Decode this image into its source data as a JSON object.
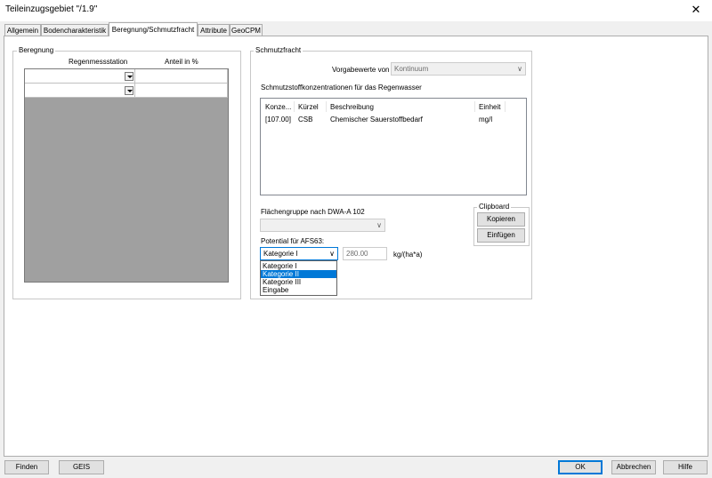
{
  "window": {
    "title": "Teileinzugsgebiet \"/1.9\"",
    "close_symbol": "✕"
  },
  "tabs": [
    {
      "label": "Allgemein"
    },
    {
      "label": "Bodencharakteristik"
    },
    {
      "label": "Beregnung/Schmutzfracht"
    },
    {
      "label": "Attribute"
    },
    {
      "label": "GeoCPM"
    }
  ],
  "beregnung": {
    "label": "Beregnung",
    "col_station": "Regenmessstation",
    "col_anteil": "Anteil in %"
  },
  "schmutzfracht": {
    "label": "Schmutzfracht",
    "vorgabe_label": "Vorgabewerte von",
    "vorgabe_value": "Kontinuum",
    "konz_label": "Schmutzstoffkonzentrationen für das Regenwasser",
    "table": {
      "headers": [
        "Konze...",
        "Kürzel",
        "Beschreibung",
        "Einheit"
      ],
      "rows": [
        {
          "konz": "[107.00]",
          "kuerzel": "CSB",
          "beschreibung": "Chemischer Sauerstoffbedarf",
          "einheit": "mg/l"
        }
      ]
    },
    "flaechen_label": "Flächengruppe nach DWA-A 102",
    "flaechen_value": "",
    "potential_label": "Potential für AFS63:",
    "potential_selected": "Kategorie I",
    "potential_value": "280.00",
    "potential_unit": "kg/(ha*a)",
    "potential_options": [
      "Kategorie I",
      "Kategorie II",
      "Kategorie III",
      "Eingabe"
    ]
  },
  "clipboard": {
    "label": "Clipboard",
    "copy": "Kopieren",
    "paste": "Einfügen"
  },
  "footer": {
    "find": "Finden",
    "geis": "GEIS",
    "ok": "OK",
    "cancel": "Abbrechen",
    "help": "Hilfe"
  },
  "colors": {
    "accent": "#0078d7",
    "grid_bg": "#a0a0a0"
  },
  "icons": {
    "chevron": "chevron-down-icon",
    "close": "close-icon"
  }
}
